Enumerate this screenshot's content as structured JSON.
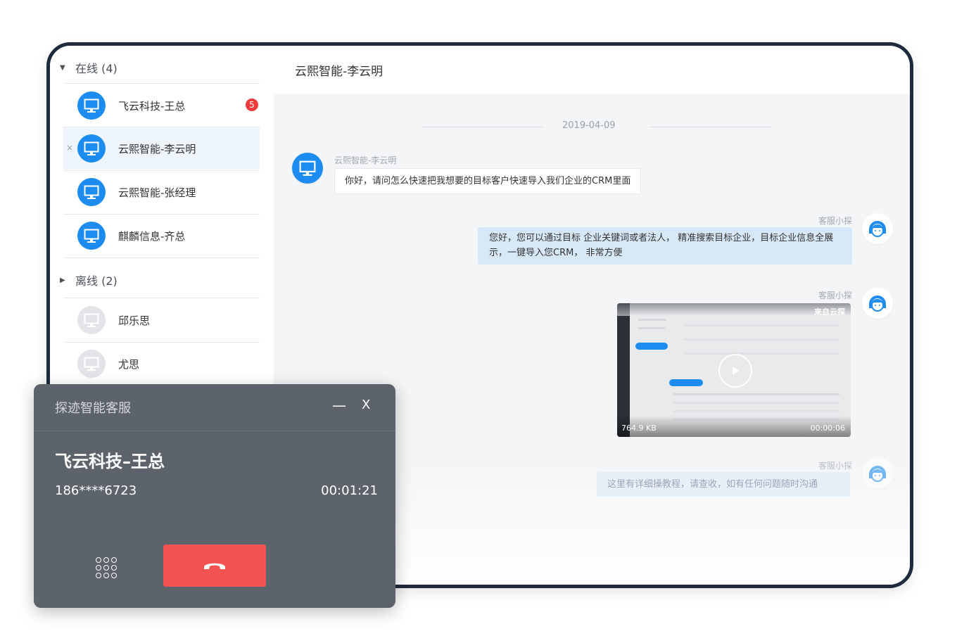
{
  "sidebar": {
    "online_group": "在线 (4)",
    "offline_group": "离线 (2)",
    "online_contacts": [
      {
        "name": "飞云科技-王总",
        "badge": "5"
      },
      {
        "name": "云熙智能-李云明",
        "close": "×"
      },
      {
        "name": "云熙智能-张经理"
      },
      {
        "name": "麒麟信息-齐总"
      }
    ],
    "offline_contacts": [
      {
        "name": "邱乐思"
      },
      {
        "name": "尤思"
      }
    ]
  },
  "chat": {
    "header_title": "云熙智能-李云明",
    "date": "2019-04-09",
    "messages": [
      {
        "sender": "云熙智能-李云明",
        "text": "你好，请问怎么快速把我想要的目标客户快速导入我们企业的CRM里面"
      },
      {
        "sender": "客服小探",
        "text": "您好，您可以通过目标 企业关键词或者法人， 精准搜索目标企业，目标企业信息全展示，一键导入您CRM， 非常方便"
      },
      {
        "sender": "客服小探",
        "video_size": "764.9 KB",
        "video_duration": "00:00:06",
        "video_brand": "来自云探"
      },
      {
        "sender": "客服小探",
        "text": "这里有详细操教程，请查收，如有任何问题随时沟通"
      }
    ]
  },
  "call_panel": {
    "title": "探迹智能客服",
    "minimize": "—",
    "close": "X",
    "contact_name": "飞云科技–王总",
    "phone": "186****6723",
    "duration": "00:01:21"
  },
  "colors": {
    "brand_blue": "#1d8cf0",
    "hangup_red": "#f25252",
    "badge_red": "#ef3b3b",
    "panel_gray": "#5c636b"
  },
  "icons": {
    "contact_avatar": "monitor-icon",
    "agent_avatar": "agent-headset-icon",
    "keypad": "keypad-icon",
    "hangup": "phone-hangup-icon",
    "play": "play-icon"
  }
}
